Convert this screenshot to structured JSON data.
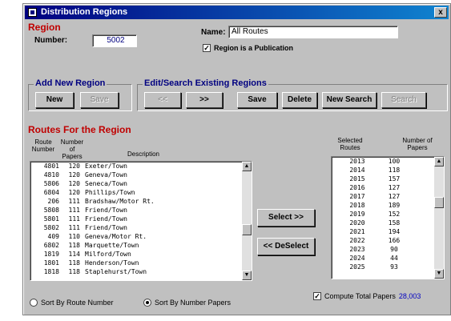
{
  "window": {
    "title": "Distribution Regions",
    "close": "x"
  },
  "region": {
    "heading": "Region",
    "number_label": "Number:",
    "number_value": "5002",
    "name_label": "Name:",
    "name_value": "All Routes",
    "publication_check": "Region is a Publication"
  },
  "add_group": {
    "title": "Add New Region",
    "new": "New",
    "save": "Save"
  },
  "edit_group": {
    "title": "Edit/Search Existing Regions",
    "prev": "<<",
    "next": ">>",
    "save": "Save",
    "delete": "Delete",
    "new_search": "New Search",
    "search": "Search"
  },
  "routes": {
    "heading": "Routes For the Region",
    "col_route": "Route Number",
    "col_papers": "Number of Papers",
    "col_desc": "Description",
    "rows": [
      [
        "4801",
        "120",
        "Exeter/Town"
      ],
      [
        "4810",
        "120",
        "Geneva/Town"
      ],
      [
        "5806",
        "120",
        "Seneca/Town"
      ],
      [
        "6804",
        "120",
        "Phillips/Town"
      ],
      [
        "206",
        "111",
        "Bradshaw/Motor Rt."
      ],
      [
        "5808",
        "111",
        "Friend/Town"
      ],
      [
        "5801",
        "111",
        "Friend/Town"
      ],
      [
        "5802",
        "111",
        "Friend/Town"
      ],
      [
        "409",
        "110",
        "Geneva/Motor Rt."
      ],
      [
        "6802",
        "118",
        "Marquette/Town"
      ],
      [
        "1819",
        "114",
        "Milford/Town"
      ],
      [
        "1801",
        "118",
        "Henderson/Town"
      ],
      [
        "1818",
        "118",
        "Staplehurst/Town"
      ]
    ]
  },
  "selected": {
    "col_selected": "Selected Routes",
    "col_number": "Number of Papers",
    "rows": [
      [
        "2013",
        "100"
      ],
      [
        "2014",
        "118"
      ],
      [
        "2015",
        "157"
      ],
      [
        "2016",
        "127"
      ],
      [
        "2017",
        "127"
      ],
      [
        "2018",
        "189"
      ],
      [
        "2019",
        "152"
      ],
      [
        "2020",
        "158"
      ],
      [
        "2021",
        "194"
      ],
      [
        "2022",
        "166"
      ],
      [
        "2023",
        "90"
      ],
      [
        "2024",
        "44"
      ],
      [
        "2025",
        "93"
      ]
    ]
  },
  "actions": {
    "select": "Select >>",
    "deselect": "<< DeSelect"
  },
  "sort": {
    "by_route": "Sort By Route Number",
    "by_papers": "Sort By Number Papers"
  },
  "total": {
    "label": "Compute Total Papers",
    "value": "28,003"
  }
}
